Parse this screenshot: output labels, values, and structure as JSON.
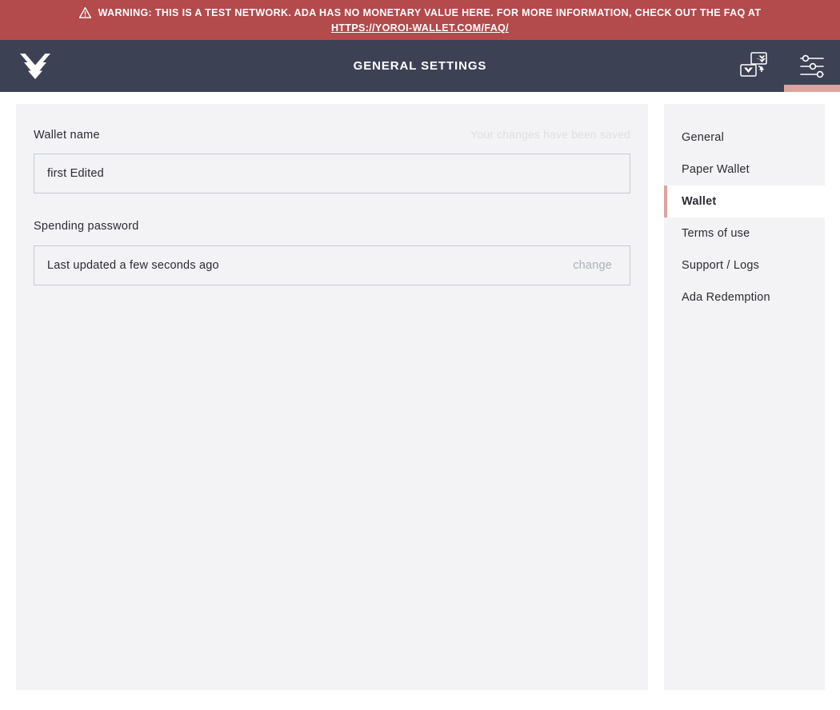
{
  "warning_banner": {
    "icon": "warning-triangle-icon",
    "message": "WARNING: THIS IS A TEST NETWORK. ADA HAS NO MONETARY VALUE HERE. FOR MORE INFORMATION, CHECK OUT THE FAQ AT",
    "link_text": "HTTPS://YOROI-WALLET.COM/FAQ/",
    "background_color": "#b34a4c",
    "text_color": "#ffffff"
  },
  "header": {
    "logo": "yoroi-logo-icon",
    "title": "GENERAL SETTINGS",
    "actions": [
      {
        "icon": "wallet-switch-icon",
        "active": false
      },
      {
        "icon": "settings-sliders-icon",
        "active": true
      }
    ],
    "background_color": "#3c4254",
    "active_indicator_color": "#dba49c"
  },
  "settings": {
    "wallet_name": {
      "label": "Wallet name",
      "value": "first Edited",
      "placeholder": "Wallet name",
      "saved_message": "Your changes have been saved"
    },
    "spending_password": {
      "label": "Spending password",
      "status": "Last updated a few seconds ago",
      "change_label": "change"
    }
  },
  "menu": {
    "items": [
      {
        "label": "General",
        "active": false
      },
      {
        "label": "Paper Wallet",
        "active": false
      },
      {
        "label": "Wallet",
        "active": true
      },
      {
        "label": "Terms of use",
        "active": false
      },
      {
        "label": "Support / Logs",
        "active": false
      },
      {
        "label": "Ada Redemption",
        "active": false
      }
    ],
    "active_marker_color": "#dba49c"
  }
}
